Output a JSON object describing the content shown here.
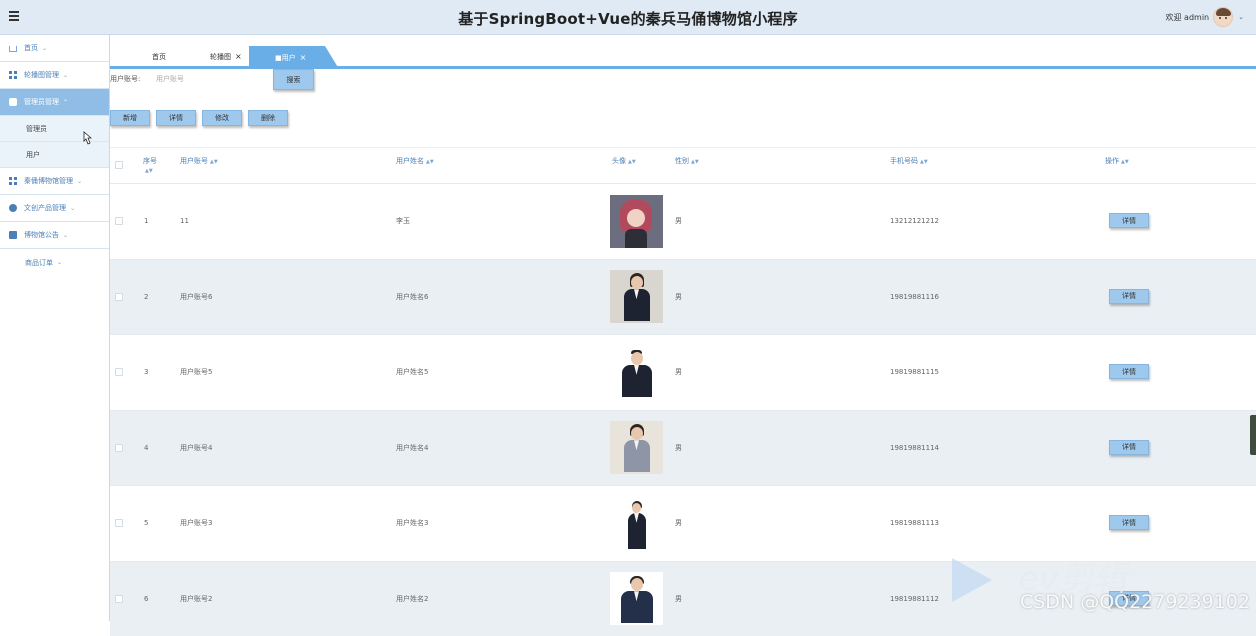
{
  "header": {
    "title": "基于SpringBoot+Vue的秦兵马俑博物馆小程序",
    "welcome": "欢迎 admin",
    "menu_icon": "hamburger-icon",
    "colors": {
      "header_bg": "#dfeaf5",
      "accent": "#6aaee8"
    }
  },
  "sidebar": {
    "items": [
      {
        "label": "首页",
        "icon": "home-icon"
      },
      {
        "label": "轮播图管理",
        "icon": "grid-icon"
      },
      {
        "label": "管理员管理",
        "icon": "database-icon",
        "active": true
      },
      {
        "label": "管理员",
        "sub": true
      },
      {
        "label": "用户",
        "sub": true
      },
      {
        "label": "秦俑博物馆管理",
        "icon": "grid-icon"
      },
      {
        "label": "文创产品管理",
        "icon": "circle-icon"
      },
      {
        "label": "博物馆公告",
        "icon": "box-icon"
      },
      {
        "label": "商品订单"
      }
    ]
  },
  "tabs": [
    {
      "label": "首页"
    },
    {
      "label": "轮播图",
      "closable": true
    },
    {
      "label": "■用户",
      "closable": true,
      "active": true
    }
  ],
  "search": {
    "label": "用户账号:",
    "placeholder": "用户账号",
    "button": "搜索"
  },
  "toolbar": {
    "add": "新增",
    "detail": "详情",
    "edit": "修改",
    "delete": "删除"
  },
  "table": {
    "columns": [
      "序号",
      "用户账号",
      "用户姓名",
      "头像",
      "性别",
      "手机号码",
      "操作"
    ],
    "rows": [
      {
        "index": "1",
        "account": "11",
        "name": "李玉",
        "gender": "男",
        "phone": "13212121212",
        "action": "详情"
      },
      {
        "index": "2",
        "account": "用户账号6",
        "name": "用户姓名6",
        "gender": "男",
        "phone": "19819881116",
        "action": "详情"
      },
      {
        "index": "3",
        "account": "用户账号5",
        "name": "用户姓名5",
        "gender": "男",
        "phone": "19819881115",
        "action": "详情"
      },
      {
        "index": "4",
        "account": "用户账号4",
        "name": "用户姓名4",
        "gender": "男",
        "phone": "19819881114",
        "action": "详情"
      },
      {
        "index": "5",
        "account": "用户账号3",
        "name": "用户姓名3",
        "gender": "男",
        "phone": "19819881113",
        "action": "详情"
      },
      {
        "index": "6",
        "account": "用户账号2",
        "name": "用户姓名2",
        "gender": "男",
        "phone": "19819881112",
        "action": "详情"
      }
    ]
  },
  "watermark": {
    "csdn": "CSDN @QQ2279239102",
    "ev": "ev剪辑"
  }
}
